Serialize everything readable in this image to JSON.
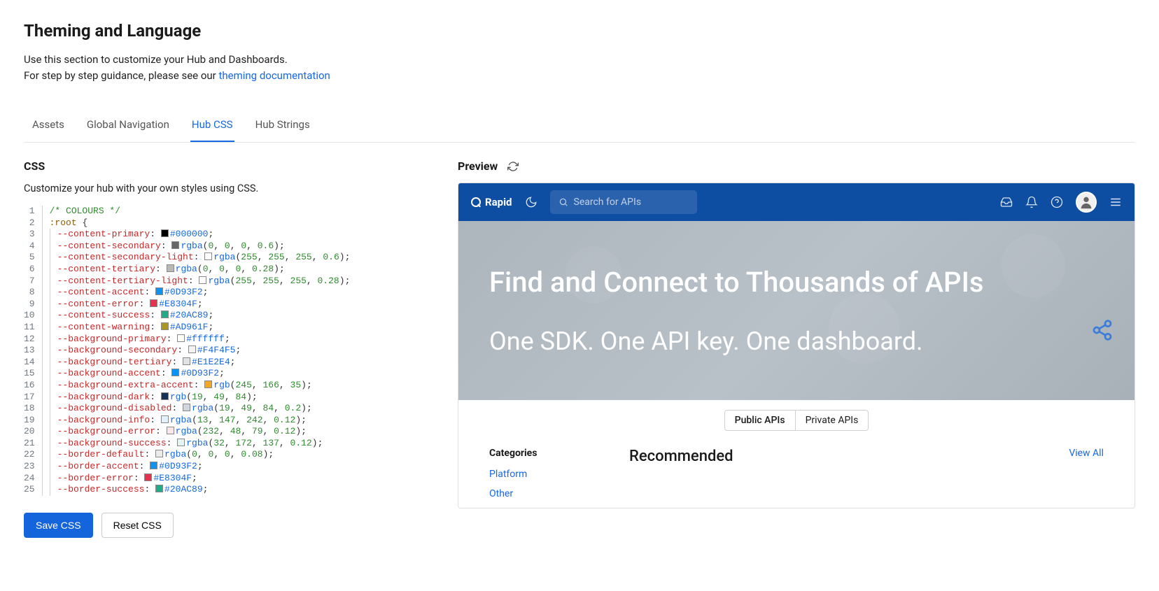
{
  "header": {
    "title": "Theming and Language",
    "desc_line1": "Use this section to customize your Hub and Dashboards.",
    "desc_line2_prefix": "For step by step guidance, please see our ",
    "desc_link": "theming documentation"
  },
  "tabs": {
    "items": [
      "Assets",
      "Global Navigation",
      "Hub CSS",
      "Hub Strings"
    ],
    "active_index": 2
  },
  "css_panel": {
    "title": "CSS",
    "desc": "Customize your hub with your own styles using CSS.",
    "save_label": "Save CSS",
    "reset_label": "Reset CSS",
    "lines": [
      {
        "n": 1,
        "type": "comment",
        "text": "/* COLOURS */"
      },
      {
        "n": 2,
        "type": "selector",
        "text": ":root {"
      },
      {
        "n": 3,
        "type": "decl",
        "prop": "--content-primary",
        "valueKind": "hex",
        "value": "#000000",
        "swatch": "#000000"
      },
      {
        "n": 4,
        "type": "decl",
        "prop": "--content-secondary",
        "valueKind": "rgba",
        "r": 0,
        "g": 0,
        "b": 0,
        "a": 0.6,
        "swatch": "rgba(0,0,0,0.6)"
      },
      {
        "n": 5,
        "type": "decl",
        "prop": "--content-secondary-light",
        "valueKind": "rgba",
        "r": 255,
        "g": 255,
        "b": 255,
        "a": 0.6,
        "swatch": "rgba(255,255,255,0.6)"
      },
      {
        "n": 6,
        "type": "decl",
        "prop": "--content-tertiary",
        "valueKind": "rgba",
        "r": 0,
        "g": 0,
        "b": 0,
        "a": 0.28,
        "swatch": "rgba(0,0,0,0.28)"
      },
      {
        "n": 7,
        "type": "decl",
        "prop": "--content-tertiary-light",
        "valueKind": "rgba",
        "r": 255,
        "g": 255,
        "b": 255,
        "a": 0.28,
        "swatch": "rgba(255,255,255,0.28)"
      },
      {
        "n": 8,
        "type": "decl",
        "prop": "--content-accent",
        "valueKind": "hex",
        "value": "#0D93F2",
        "swatch": "#0D93F2"
      },
      {
        "n": 9,
        "type": "decl",
        "prop": "--content-error",
        "valueKind": "hex",
        "value": "#E8304F",
        "swatch": "#E8304F"
      },
      {
        "n": 10,
        "type": "decl",
        "prop": "--content-success",
        "valueKind": "hex",
        "value": "#20AC89",
        "swatch": "#20AC89"
      },
      {
        "n": 11,
        "type": "decl",
        "prop": "--content-warning",
        "valueKind": "hex",
        "value": "#AD961F",
        "swatch": "#AD961F"
      },
      {
        "n": 12,
        "type": "decl",
        "prop": "--background-primary",
        "valueKind": "hex",
        "value": "#ffffff",
        "swatch": "#ffffff"
      },
      {
        "n": 13,
        "type": "decl",
        "prop": "--background-secondary",
        "valueKind": "hex",
        "value": "#F4F4F5",
        "swatch": "#F4F4F5"
      },
      {
        "n": 14,
        "type": "decl",
        "prop": "--background-tertiary",
        "valueKind": "hex",
        "value": "#E1E2E4",
        "swatch": "#E1E2E4"
      },
      {
        "n": 15,
        "type": "decl",
        "prop": "--background-accent",
        "valueKind": "hex",
        "value": "#0D93F2",
        "swatch": "#0D93F2"
      },
      {
        "n": 16,
        "type": "decl",
        "prop": "--background-extra-accent",
        "valueKind": "rgb",
        "r": 245,
        "g": 166,
        "b": 35,
        "swatch": "rgb(245,166,35)"
      },
      {
        "n": 17,
        "type": "decl",
        "prop": "--background-dark",
        "valueKind": "rgb",
        "r": 19,
        "g": 49,
        "b": 84,
        "swatch": "rgb(19,49,84)"
      },
      {
        "n": 18,
        "type": "decl",
        "prop": "--background-disabled",
        "valueKind": "rgba",
        "r": 19,
        "g": 49,
        "b": 84,
        "a": 0.2,
        "swatch": "rgba(19,49,84,0.2)"
      },
      {
        "n": 19,
        "type": "decl",
        "prop": "--background-info",
        "valueKind": "rgba",
        "r": 13,
        "g": 147,
        "b": 242,
        "a": 0.12,
        "swatch": "rgba(13,147,242,0.12)"
      },
      {
        "n": 20,
        "type": "decl",
        "prop": "--background-error",
        "valueKind": "rgba",
        "r": 232,
        "g": 48,
        "b": 79,
        "a": 0.12,
        "swatch": "rgba(232,48,79,0.12)"
      },
      {
        "n": 21,
        "type": "decl",
        "prop": "--background-success",
        "valueKind": "rgba",
        "r": 32,
        "g": 172,
        "b": 137,
        "a": 0.12,
        "swatch": "rgba(32,172,137,0.12)"
      },
      {
        "n": 22,
        "type": "decl",
        "prop": "--border-default",
        "valueKind": "rgba",
        "r": 0,
        "g": 0,
        "b": 0,
        "a": 0.08,
        "swatch": "rgba(0,0,0,0.08)"
      },
      {
        "n": 23,
        "type": "decl",
        "prop": "--border-accent",
        "valueKind": "hex",
        "value": "#0D93F2",
        "swatch": "#0D93F2"
      },
      {
        "n": 24,
        "type": "decl",
        "prop": "--border-error",
        "valueKind": "hex",
        "value": "#E8304F",
        "swatch": "#E8304F"
      },
      {
        "n": 25,
        "type": "decl",
        "prop": "--border-success",
        "valueKind": "hex",
        "value": "#20AC89",
        "swatch": "#20AC89"
      }
    ]
  },
  "preview": {
    "title": "Preview",
    "logo_text": "Rapid",
    "search_placeholder": "Search for APIs",
    "hero_title": "Find and Connect to Thousands of APIs",
    "hero_subtitle": "One SDK. One API key. One dashboard.",
    "tabs": [
      "Public APIs",
      "Private APIs"
    ],
    "active_tab_index": 0,
    "categories_label": "Categories",
    "categories": [
      "Platform",
      "Other"
    ],
    "recommended_label": "Recommended",
    "view_all_label": "View All"
  }
}
